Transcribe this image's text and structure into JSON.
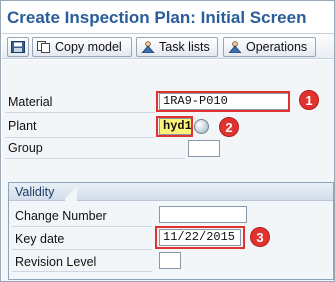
{
  "window": {
    "title": "Create Inspection Plan: Initial Screen"
  },
  "toolbar": {
    "buttons": [
      {
        "icon": "save-icon",
        "label": ""
      },
      {
        "icon": "copy-model-icon",
        "label": "Copy model"
      },
      {
        "icon": "task-lists-icon",
        "label": "Task lists"
      },
      {
        "icon": "operations-icon",
        "label": "Operations"
      }
    ]
  },
  "form": {
    "material": {
      "label": "Material",
      "value": "1RA9-P010"
    },
    "plant": {
      "label": "Plant",
      "value": "hyd1"
    },
    "group": {
      "label": "Group",
      "value": ""
    }
  },
  "validity": {
    "title": "Validity",
    "change_number": {
      "label": "Change Number",
      "value": ""
    },
    "key_date": {
      "label": "Key date",
      "value": "11/22/2015"
    },
    "revision_level": {
      "label": "Revision Level",
      "value": ""
    }
  },
  "annotations": {
    "n1": "1",
    "n2": "2",
    "n3": "3"
  },
  "colors": {
    "title": "#2a5d9a",
    "annotation": "#e0322e",
    "required_field": "#fdf37a"
  }
}
